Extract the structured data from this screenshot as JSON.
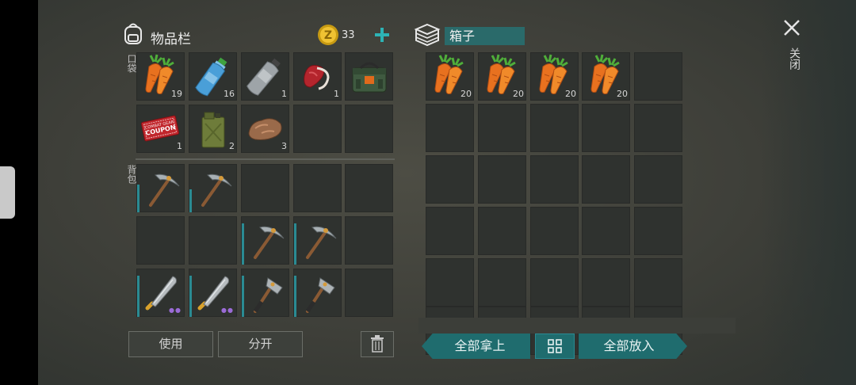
{
  "inventory": {
    "title": "物品栏",
    "coins": "33",
    "coin_symbol": "Z",
    "pocket_label": "口袋",
    "backpack_label": "背包",
    "pocket_items": [
      {
        "name": "carrot",
        "qty": "19"
      },
      {
        "name": "water-bottle",
        "qty": "16"
      },
      {
        "name": "empty-bottle",
        "qty": "1"
      },
      {
        "name": "raw-meat",
        "qty": "1"
      },
      {
        "name": "green-bag",
        "qty": ""
      },
      {
        "name": "coupon",
        "qty": "1",
        "text_top": "COMBAT GEAR",
        "text_main": "COUPON"
      },
      {
        "name": "jerrycan",
        "qty": "2"
      },
      {
        "name": "stone",
        "qty": "3"
      },
      {
        "name": "empty",
        "qty": ""
      },
      {
        "name": "empty",
        "qty": ""
      }
    ],
    "backpack_items": [
      {
        "name": "pickaxe",
        "durability": 0.6
      },
      {
        "name": "pickaxe",
        "durability": 0.5
      },
      {
        "name": "empty"
      },
      {
        "name": "empty"
      },
      {
        "name": "empty"
      },
      {
        "name": "empty"
      },
      {
        "name": "empty"
      },
      {
        "name": "pickaxe",
        "durability": 0.9
      },
      {
        "name": "pickaxe",
        "durability": 0.9
      },
      {
        "name": "empty"
      },
      {
        "name": "machete",
        "durability": 0.9
      },
      {
        "name": "machete",
        "durability": 0.9
      },
      {
        "name": "hatchet",
        "durability": 0.9
      },
      {
        "name": "hatchet",
        "durability": 0.9
      },
      {
        "name": "empty"
      }
    ],
    "use_button": "使用",
    "split_button": "分开"
  },
  "box": {
    "title": "箱子",
    "items": [
      {
        "name": "carrot",
        "qty": "20"
      },
      {
        "name": "carrot",
        "qty": "20"
      },
      {
        "name": "carrot",
        "qty": "20"
      },
      {
        "name": "carrot",
        "qty": "20"
      }
    ],
    "take_all_button": "全部拿上",
    "put_all_button": "全部放入"
  },
  "close_label": "关闭",
  "colors": {
    "accent": "#1f6c6e",
    "accent_light": "#2a8b93"
  }
}
